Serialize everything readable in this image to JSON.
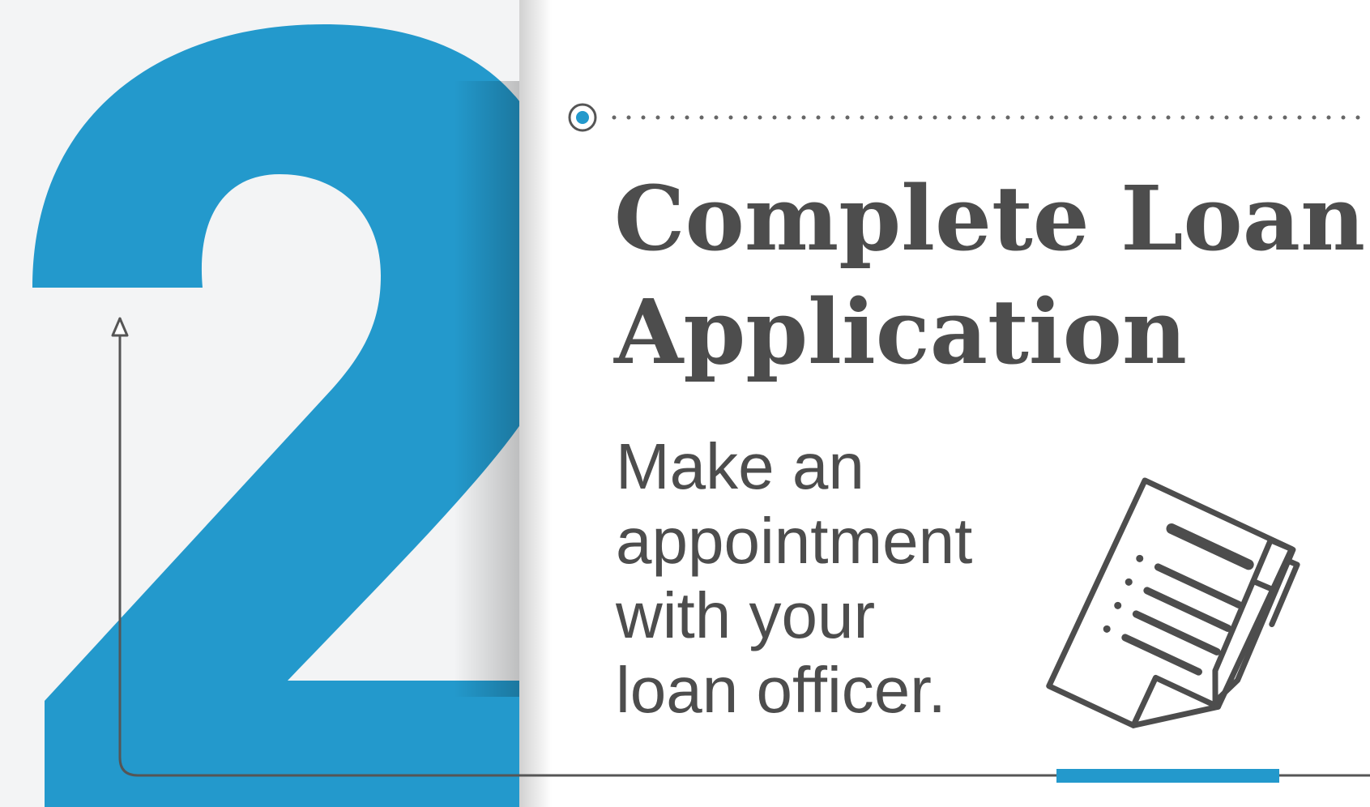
{
  "step": {
    "number": "2",
    "title_lines": [
      "Complete Loan",
      "Application"
    ],
    "description_lines": [
      "Make an",
      "appointment",
      "with your",
      "loan officer."
    ]
  },
  "colors": {
    "background": "#f3f4f5",
    "card": "#ffffff",
    "accent": "#2399cc",
    "text": "#4d4d4d",
    "line": "#555555"
  },
  "icons": [
    "document-pen-icon",
    "arrow-up-icon"
  ]
}
